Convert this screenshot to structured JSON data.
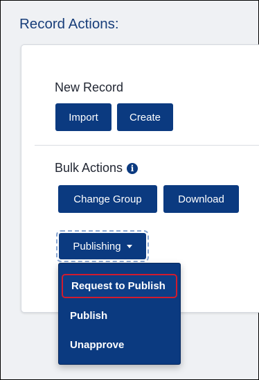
{
  "panel": {
    "title": "Record Actions:"
  },
  "new_record": {
    "heading": "New Record",
    "import_label": "Import",
    "create_label": "Create"
  },
  "bulk_actions": {
    "heading": "Bulk Actions",
    "info_icon": "info-circle-icon",
    "change_group_label": "Change Group",
    "download_label": "Download",
    "publishing_label": "Publishing"
  },
  "publishing_menu": {
    "items": [
      {
        "label": "Request to Publish",
        "highlighted": true
      },
      {
        "label": "Publish",
        "highlighted": false
      },
      {
        "label": "Unapprove",
        "highlighted": false
      }
    ]
  },
  "colors": {
    "button_bg": "#0b3a80",
    "title_color": "#183e7a",
    "highlight_outline": "#d11b2e",
    "page_bg": "#eff1f4"
  }
}
